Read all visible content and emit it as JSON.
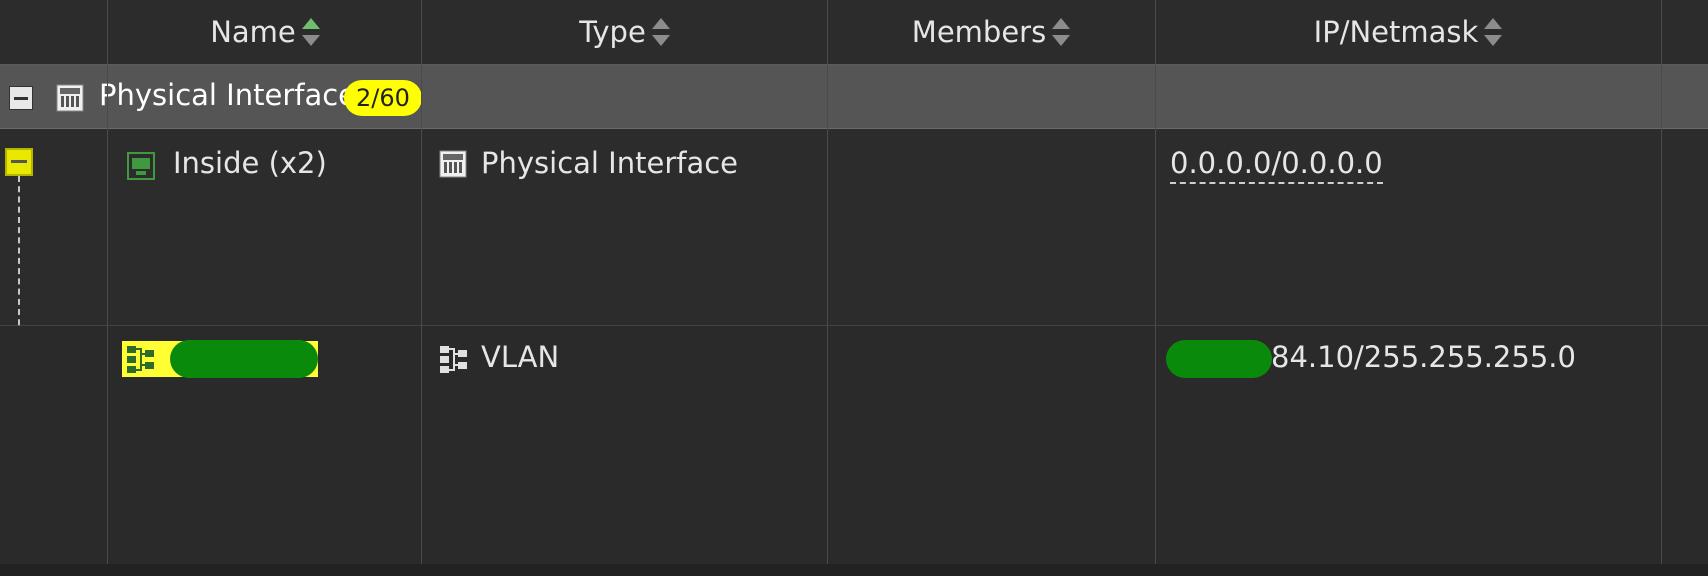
{
  "table": {
    "columns": [
      {
        "label": "Name",
        "sort": "asc"
      },
      {
        "label": "Type",
        "sort": "none"
      },
      {
        "label": "Members",
        "sort": "none"
      },
      {
        "label": "IP/Netmask",
        "sort": "none"
      }
    ],
    "group": {
      "title": "Physical Interface",
      "badge": "2/60",
      "icon": "physical-interface-icon"
    },
    "rows": [
      {
        "name": "Inside (x2)",
        "name_icon": "port-icon",
        "type": "Physical Interface",
        "type_icon": "physical-interface-icon",
        "members": "",
        "ip": "0.0.0.0/0.0.0.0"
      },
      {
        "name": "",
        "name_icon": "vlan-icon",
        "type": "VLAN",
        "type_icon": "vlan-icon",
        "members": "",
        "ip": "84.10/255.255.255.0"
      }
    ]
  },
  "colors": {
    "accent_yellow": "#ffff00",
    "redaction_green": "#0a8a0a",
    "sort_active": "#6fbf6f"
  }
}
